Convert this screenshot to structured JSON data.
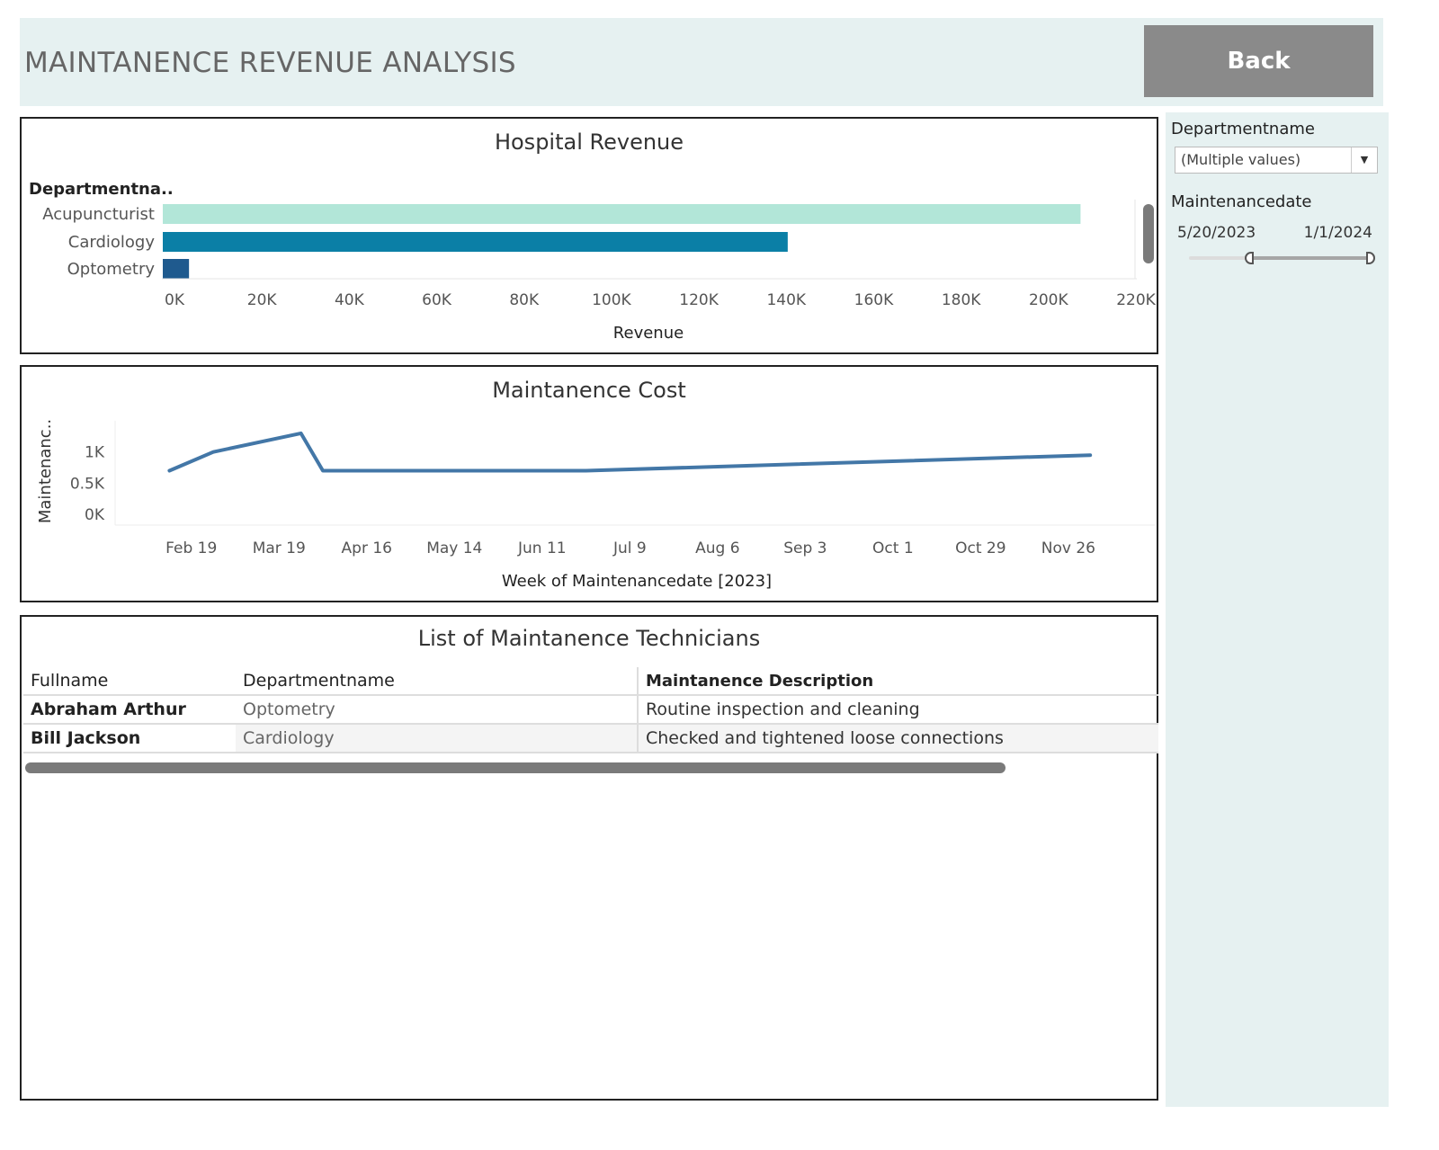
{
  "header": {
    "title": "MAINTANENCE REVENUE ANALYSIS",
    "back_label": "Back",
    "bg_color": "#e6f1f1",
    "button_color": "#8a8a8a"
  },
  "revenue_panel": {
    "title": "Hospital Revenue",
    "row_header": "Departmentna..",
    "xlabel": "Revenue"
  },
  "cost_panel": {
    "title": "Maintanence Cost",
    "ylabel": "Maintenanc..",
    "xlabel": "Week of Maintenancedate [2023]"
  },
  "technicians_panel": {
    "title": "List of Maintanence Technicians",
    "columns": [
      "Fullname",
      "Departmentname",
      "Maintanence Description"
    ],
    "rows": [
      [
        "Abraham Arthur",
        "Optometry",
        "Routine inspection and cleaning"
      ],
      [
        "Bill Jackson",
        "Cardiology",
        "Checked and tightened loose connections"
      ]
    ]
  },
  "filters": {
    "department": {
      "label": "Departmentname",
      "value": "(Multiple values)"
    },
    "date": {
      "label": "Maintenancedate",
      "start": "5/20/2023",
      "end": "1/1/2024",
      "selected_fraction": [
        0.33,
        1.0
      ]
    }
  },
  "chart_data": [
    {
      "type": "bar",
      "orientation": "horizontal",
      "title": "Hospital Revenue",
      "xlabel": "Revenue",
      "ylabel": "Departmentna..",
      "categories": [
        "Acupuncturist",
        "Cardiology",
        "Optometry"
      ],
      "values": [
        210000,
        143000,
        6000
      ],
      "colors": [
        "#b2e6d8",
        "#0b7fa6",
        "#1f5a8e"
      ],
      "xlim": [
        0,
        220000
      ],
      "xticks": [
        0,
        20000,
        40000,
        60000,
        80000,
        100000,
        120000,
        140000,
        160000,
        180000,
        200000,
        220000
      ],
      "xtick_labels": [
        "0K",
        "20K",
        "40K",
        "60K",
        "80K",
        "100K",
        "120K",
        "140K",
        "160K",
        "180K",
        "200K",
        "220K"
      ],
      "grid": false
    },
    {
      "type": "line",
      "title": "Maintanence Cost",
      "xlabel": "Week of Maintenancedate [2023]",
      "ylabel": "Maintenanc..",
      "x": [
        "2023-02-12",
        "2023-02-26",
        "2023-03-26",
        "2023-04-02",
        "2023-06-25",
        "2023-12-03"
      ],
      "y": [
        700,
        1000,
        1300,
        700,
        700,
        950
      ],
      "color": "#4377a7",
      "xlim": [
        "2023-02-05",
        "2023-12-17"
      ],
      "ylim": [
        0,
        1400
      ],
      "yticks": [
        0,
        500,
        1000
      ],
      "ytick_labels": [
        "0K",
        "0.5K",
        "1K"
      ],
      "xtick_dates": [
        "2023-02-19",
        "2023-03-19",
        "2023-04-16",
        "2023-05-14",
        "2023-06-11",
        "2023-07-09",
        "2023-08-06",
        "2023-09-03",
        "2023-10-01",
        "2023-10-29",
        "2023-11-26"
      ],
      "xtick_labels": [
        "Feb 19",
        "Mar 19",
        "Apr 16",
        "May 14",
        "Jun 11",
        "Jul 9",
        "Aug 6",
        "Sep 3",
        "Oct 1",
        "Oct 29",
        "Nov 26"
      ],
      "grid": false
    }
  ]
}
